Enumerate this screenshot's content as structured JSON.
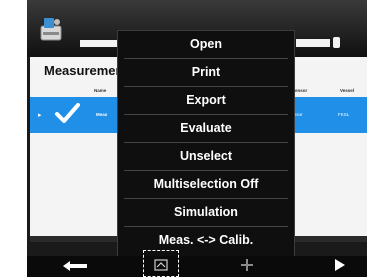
{
  "header": {
    "app_icon": "measuring-station-icon"
  },
  "panel": {
    "title": "Measurements",
    "columns": [
      {
        "label": "Name"
      },
      {
        "label": "Sensor"
      },
      {
        "label": "Vessel"
      }
    ],
    "selected_row": {
      "name": "Meas",
      "sensor": "K Sensor",
      "vessel": "FKSL"
    }
  },
  "menu": {
    "items": [
      {
        "label": "Open"
      },
      {
        "label": "Print"
      },
      {
        "label": "Export"
      },
      {
        "label": "Evaluate"
      },
      {
        "label": "Unselect"
      },
      {
        "label": "Multiselection Off"
      },
      {
        "label": "Simulation"
      },
      {
        "label": "Meas. <-> Calib."
      }
    ]
  },
  "toolbar": {
    "buttons": [
      {
        "icon": "back-arrow-icon"
      },
      {
        "icon": "context-menu-icon"
      },
      {
        "icon": "add-icon"
      },
      {
        "icon": "forward-arrow-icon"
      }
    ]
  },
  "colors": {
    "selection": "#1f8fe8",
    "menu_background": "#0f0f0f",
    "frame": "#1a1a1a"
  }
}
